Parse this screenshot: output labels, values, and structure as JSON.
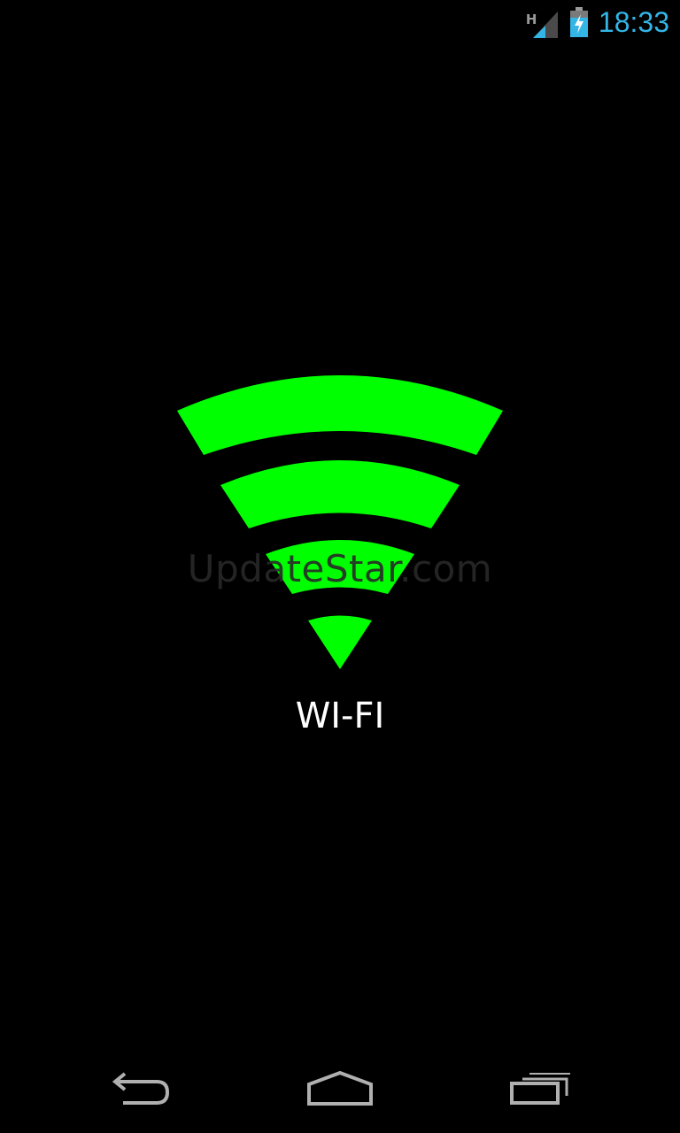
{
  "status_bar": {
    "network_type": "H",
    "time": "18:33",
    "icons": [
      "signal-icon",
      "battery-charging-icon"
    ]
  },
  "main": {
    "watermark": "UpdateStar.com",
    "label": "WI-FI",
    "icon": "wifi-icon"
  },
  "nav_bar": {
    "buttons": [
      "back-icon",
      "home-icon",
      "recent-apps-icon"
    ]
  },
  "colors": {
    "background": "#000000",
    "wifi_green": "#00ff00",
    "clock_blue": "#33b5e5",
    "label_white": "#ffffff",
    "nav_icon": "#b0b0b0"
  }
}
